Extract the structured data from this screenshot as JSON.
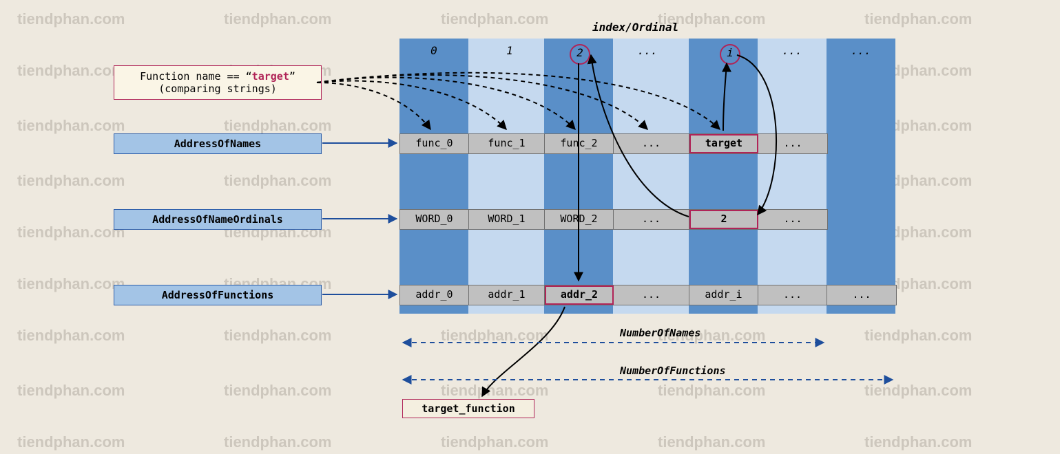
{
  "watermark_text": "tiendphan.com",
  "title_index": "index/Ordinal",
  "annotation": {
    "prefix": "Function name == “",
    "target": "target",
    "suffix": "”",
    "sub": "(comparing strings)"
  },
  "labels": {
    "names": "AddressOfNames",
    "ords": "AddressOfNameOrdinals",
    "funcs": "AddressOfFunctions"
  },
  "columns": {
    "headers": [
      "0",
      "1",
      "2",
      "...",
      "i",
      "...",
      "..."
    ]
  },
  "row_names": [
    "func_0",
    "func_1",
    "func_2",
    "...",
    "target",
    "..."
  ],
  "row_ords": [
    "WORD_0",
    "WORD_1",
    "WORD_2",
    "...",
    "2",
    "..."
  ],
  "row_funcs": [
    "addr_0",
    "addr_1",
    "addr_2",
    "...",
    "addr_i",
    "...",
    "..."
  ],
  "ranges": {
    "names": "NumberOfNames",
    "funcs": "NumberOfFunctions"
  },
  "result": "target_function"
}
